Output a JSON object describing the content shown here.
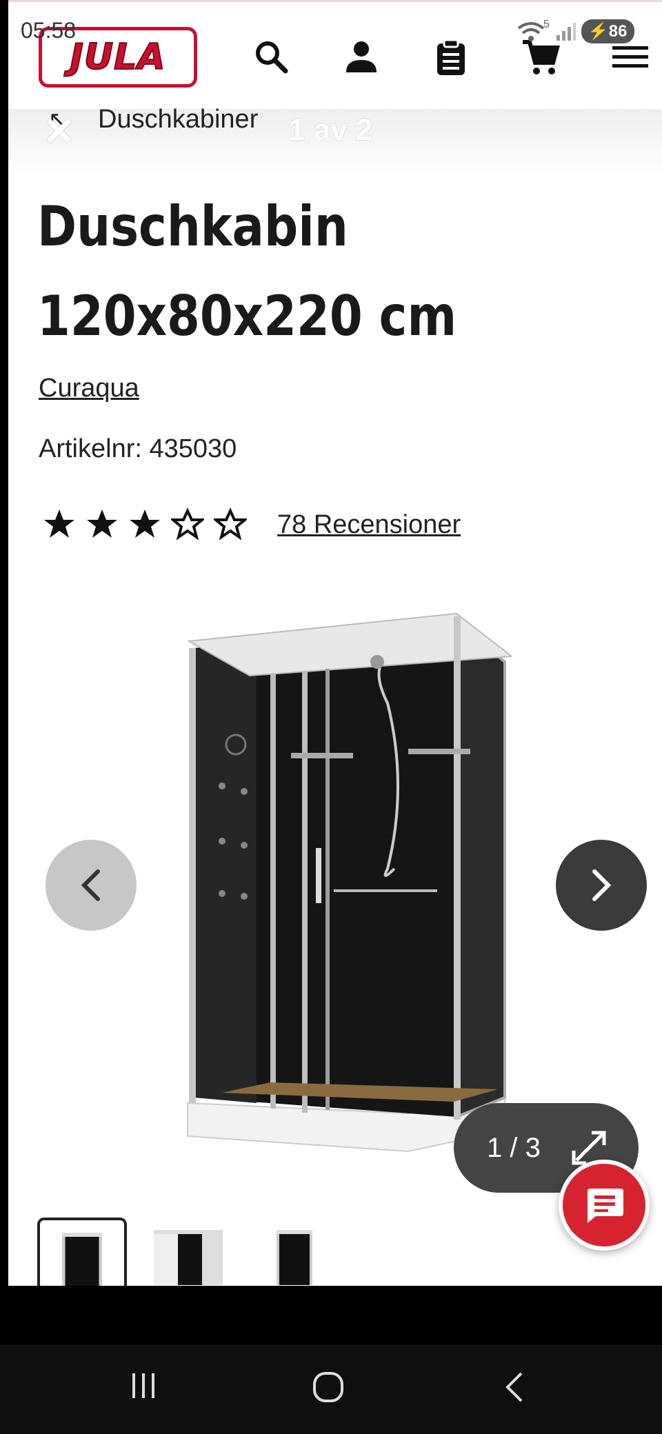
{
  "status": {
    "time": "05:58",
    "battery": "86",
    "net": "5"
  },
  "brand_logo": "JULA",
  "header_icons": [
    "search-icon",
    "user-icon",
    "clipboard-icon",
    "cart-icon",
    "menu-icon"
  ],
  "breadcrumb": {
    "label": "Duschkabiner"
  },
  "gallery_overlay": {
    "counter": "1 av 2"
  },
  "product": {
    "title_line1": "Duschkabin",
    "title_line2": "120x80x220 cm",
    "brand": "Curaqua",
    "article": "Artikelnr: 435030",
    "rating": 3,
    "rating_max": 5,
    "reviews": "78 Recensioner"
  },
  "gallery": {
    "pager": "1 / 3",
    "thumbnail_count": 3
  },
  "colors": {
    "brand_red": "#c8102e",
    "chat_red": "#d7232f"
  }
}
